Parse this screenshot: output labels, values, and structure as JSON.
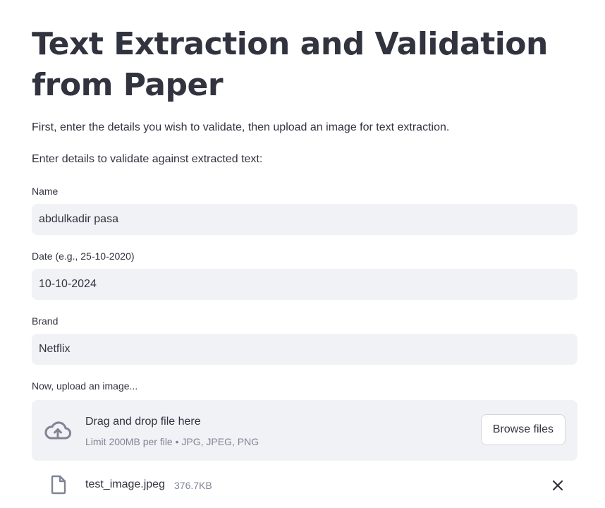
{
  "page": {
    "title": "Text Extraction and Validation from Paper",
    "intro": "First, enter the details you wish to validate, then upload an image for text extraction.",
    "subheading": "Enter details to validate against extracted text:"
  },
  "form": {
    "name": {
      "label": "Name",
      "value": "abdulkadir pasa"
    },
    "date": {
      "label": "Date (e.g., 25-10-2020)",
      "value": "10-10-2024"
    },
    "brand": {
      "label": "Brand",
      "value": "Netflix"
    }
  },
  "uploader": {
    "label": "Now, upload an image...",
    "drop_title": "Drag and drop file here",
    "limit_text": "Limit 200MB per file • JPG, JPEG, PNG",
    "browse_label": "Browse files",
    "icon": "cloud-upload-icon"
  },
  "uploaded_file": {
    "name": "test_image.jpeg",
    "size": "376.7KB",
    "icon": "file-icon",
    "remove_icon": "close-icon"
  },
  "colors": {
    "text": "#31333f",
    "muted": "#808495",
    "input_bg": "#f0f2f6",
    "icon": "#808495"
  }
}
